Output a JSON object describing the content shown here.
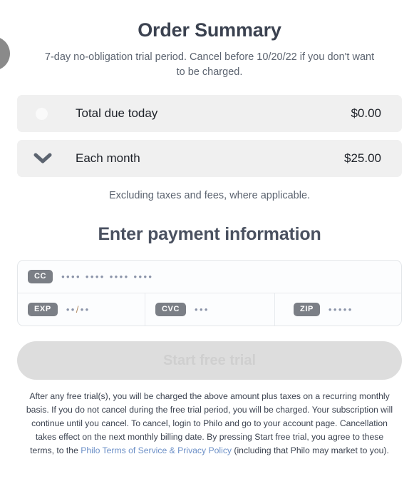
{
  "edge": {
    "circle_icon": "avatar-circle"
  },
  "header": {
    "title": "Order Summary",
    "trial_note": "7-day no-obligation trial period. Cancel before 10/20/22 if you don't want to be charged."
  },
  "summary": {
    "rows": [
      {
        "icon": "dot-icon",
        "label": "Total due today",
        "price": "$0.00"
      },
      {
        "icon": "chevron-down-icon",
        "label": "Each month",
        "price": "$25.00"
      }
    ],
    "excluding_note": "Excluding taxes and fees, where applicable."
  },
  "payment": {
    "title": "Enter payment information",
    "fields": [
      {
        "badge": "CC",
        "value": "•••• •••• •••• ••••"
      },
      {
        "badge": "EXP",
        "value_left": "••",
        "separator": "/",
        "value_right": "••"
      },
      {
        "badge": "CVC",
        "value": "•••"
      },
      {
        "badge": "ZIP",
        "value": "•••••"
      }
    ]
  },
  "cta": {
    "label": "Start free trial"
  },
  "legal": {
    "text_before": "After any free trial(s), you will be charged the above amount plus taxes on a recurring monthly basis. If you do not cancel during the free trial period, you will be charged. Your subscription will continue until you cancel. To cancel, login to Philo and go to your account page. Cancellation takes effect on the next monthly billing date. By pressing Start free trial, you agree to these terms, to the ",
    "link_text": "Philo Terms of Service & Privacy Policy",
    "text_after": " (including that Philo may market to you)."
  },
  "colors": {
    "row_background": "#f0f0f0",
    "badge_background": "#7b7f86",
    "dot_color": "#8a93a8",
    "link_color": "#6b8fc7",
    "cta_background": "#dddddd",
    "cta_text": "#cfcfcf"
  }
}
